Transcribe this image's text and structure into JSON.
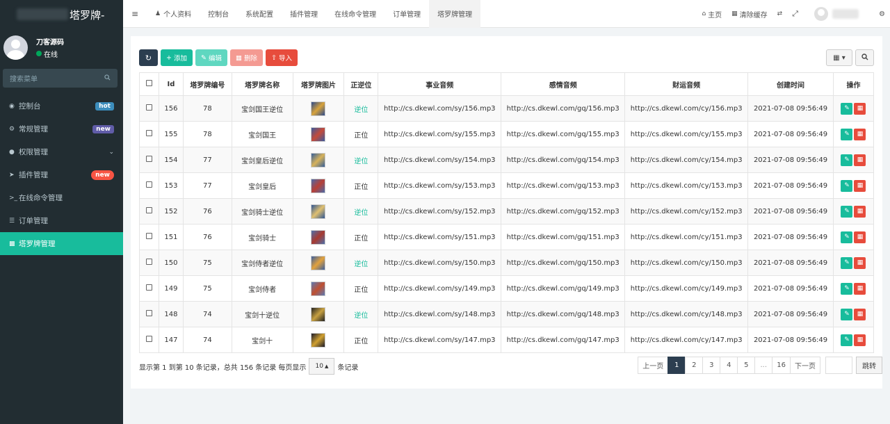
{
  "app": {
    "brand": "塔罗牌-"
  },
  "user": {
    "name": "刀客源码",
    "status": "在线"
  },
  "search": {
    "placeholder": "搜索菜单"
  },
  "sidebar": {
    "items": [
      {
        "icon": "dashboard-icon",
        "label": "控制台",
        "badge": "hot"
      },
      {
        "icon": "cogs-icon",
        "label": "常规管理",
        "badge": "new"
      },
      {
        "icon": "group-icon",
        "label": "权限管理",
        "badge": ""
      },
      {
        "icon": "rocket-icon",
        "label": "插件管理",
        "badge": "new"
      },
      {
        "icon": "terminal-icon",
        "label": "在线命令管理",
        "badge": ""
      },
      {
        "icon": "list-icon",
        "label": "订单管理",
        "badge": ""
      },
      {
        "icon": "chart-icon",
        "label": "塔罗牌管理",
        "badge": ""
      }
    ]
  },
  "topbar": {
    "tabs": [
      "个人资料",
      "控制台",
      "系统配置",
      "插件管理",
      "在线命令管理",
      "订单管理",
      "塔罗牌管理"
    ],
    "home": "主页",
    "clear_cache": "清除缓存"
  },
  "toolbar": {
    "add": "添加",
    "edit": "编辑",
    "delete": "删除",
    "import": "导入"
  },
  "table": {
    "headers": [
      "Id",
      "塔罗牌编号",
      "塔罗牌名称",
      "塔罗牌图片",
      "正逆位",
      "事业音频",
      "感情音频",
      "财运音频",
      "创建时间",
      "操作"
    ],
    "rows": [
      {
        "id": "156",
        "num": "78",
        "name": "宝剑国王逆位",
        "pos": "逆位",
        "career": "http://cs.dkewl.com/sy/156.mp3",
        "love": "http://cs.dkewl.com/gq/156.mp3",
        "wealth": "http://cs.dkewl.com/cy/156.mp3",
        "time": "2021-07-08 09:56:49"
      },
      {
        "id": "155",
        "num": "78",
        "name": "宝剑国王",
        "pos": "正位",
        "career": "http://cs.dkewl.com/sy/155.mp3",
        "love": "http://cs.dkewl.com/gq/155.mp3",
        "wealth": "http://cs.dkewl.com/cy/155.mp3",
        "time": "2021-07-08 09:56:49"
      },
      {
        "id": "154",
        "num": "77",
        "name": "宝剑皇后逆位",
        "pos": "逆位",
        "career": "http://cs.dkewl.com/sy/154.mp3",
        "love": "http://cs.dkewl.com/gq/154.mp3",
        "wealth": "http://cs.dkewl.com/cy/154.mp3",
        "time": "2021-07-08 09:56:49"
      },
      {
        "id": "153",
        "num": "77",
        "name": "宝剑皇后",
        "pos": "正位",
        "career": "http://cs.dkewl.com/sy/153.mp3",
        "love": "http://cs.dkewl.com/gq/153.mp3",
        "wealth": "http://cs.dkewl.com/cy/153.mp3",
        "time": "2021-07-08 09:56:49"
      },
      {
        "id": "152",
        "num": "76",
        "name": "宝剑骑士逆位",
        "pos": "逆位",
        "career": "http://cs.dkewl.com/sy/152.mp3",
        "love": "http://cs.dkewl.com/gq/152.mp3",
        "wealth": "http://cs.dkewl.com/cy/152.mp3",
        "time": "2021-07-08 09:56:49"
      },
      {
        "id": "151",
        "num": "76",
        "name": "宝剑骑士",
        "pos": "正位",
        "career": "http://cs.dkewl.com/sy/151.mp3",
        "love": "http://cs.dkewl.com/gq/151.mp3",
        "wealth": "http://cs.dkewl.com/cy/151.mp3",
        "time": "2021-07-08 09:56:49"
      },
      {
        "id": "150",
        "num": "75",
        "name": "宝剑侍者逆位",
        "pos": "逆位",
        "career": "http://cs.dkewl.com/sy/150.mp3",
        "love": "http://cs.dkewl.com/gq/150.mp3",
        "wealth": "http://cs.dkewl.com/cy/150.mp3",
        "time": "2021-07-08 09:56:49"
      },
      {
        "id": "149",
        "num": "75",
        "name": "宝剑侍者",
        "pos": "正位",
        "career": "http://cs.dkewl.com/sy/149.mp3",
        "love": "http://cs.dkewl.com/gq/149.mp3",
        "wealth": "http://cs.dkewl.com/cy/149.mp3",
        "time": "2021-07-08 09:56:49"
      },
      {
        "id": "148",
        "num": "74",
        "name": "宝剑十逆位",
        "pos": "逆位",
        "career": "http://cs.dkewl.com/sy/148.mp3",
        "love": "http://cs.dkewl.com/gq/148.mp3",
        "wealth": "http://cs.dkewl.com/cy/148.mp3",
        "time": "2021-07-08 09:56:49"
      },
      {
        "id": "147",
        "num": "74",
        "name": "宝剑十",
        "pos": "正位",
        "career": "http://cs.dkewl.com/sy/147.mp3",
        "love": "http://cs.dkewl.com/gq/147.mp3",
        "wealth": "http://cs.dkewl.com/cy/147.mp3",
        "time": "2021-07-08 09:56:49"
      }
    ]
  },
  "footer": {
    "summary": "显示第 1 到第 10 条记录，总共 156 条记录 每页显示",
    "page_size": "10",
    "suffix": "条记录"
  },
  "pagination": {
    "prev": "上一页",
    "pages": [
      "1",
      "2",
      "3",
      "4",
      "5",
      "...",
      "16"
    ],
    "next": "下一页",
    "jump": "跳转"
  },
  "colors": {
    "accent": "#18bc9c",
    "sidebar": "#222d32",
    "danger": "#e74c3c",
    "dark": "#2c3e50"
  }
}
